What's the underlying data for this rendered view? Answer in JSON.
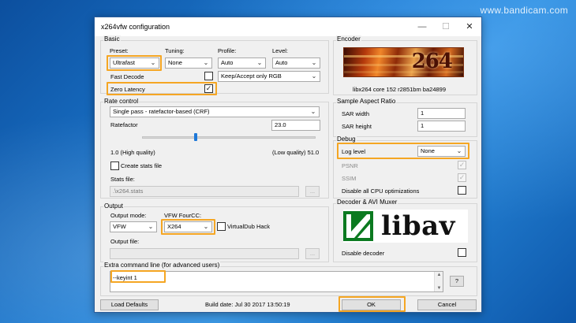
{
  "watermark": "www.bandicam.com",
  "window": {
    "title": "x264vfw configuration",
    "min": "—",
    "max": "☐",
    "close": "✕"
  },
  "basic": {
    "label": "Basic",
    "preset_label": "Preset:",
    "preset_value": "Ultrafast",
    "tuning_label": "Tuning:",
    "tuning_value": "None",
    "profile_label": "Profile:",
    "profile_value": "Auto",
    "level_label": "Level:",
    "level_value": "Auto",
    "fast_decode_label": "Fast Decode",
    "fast_decode_checked": false,
    "keep_value": "Keep/Accept only RGB",
    "zero_latency_label": "Zero Latency",
    "zero_latency_checked": true
  },
  "rate_control": {
    "label": "Rate control",
    "mode_value": "Single pass - ratefactor-based (CRF)",
    "ratefactor_label": "Ratefactor",
    "ratefactor_value": "23.0",
    "ratefactor_level": 0.31,
    "low_label": "1.0 (High quality)",
    "high_label": "(Low quality) 51.0",
    "create_stats_label": "Create stats file",
    "stats_file_label": "Stats file:",
    "stats_file_value": ".\\x264.stats",
    "browse_label": "..."
  },
  "output": {
    "label": "Output",
    "mode_label": "Output mode:",
    "mode_value": "VFW",
    "fourcc_label": "VFW FourCC:",
    "fourcc_value": "X264",
    "vdub_label": "VirtualDub Hack",
    "file_label": "Output file:",
    "browse_label": "..."
  },
  "encoder": {
    "label": "Encoder",
    "logo_text": "264",
    "version": "libx264 core 152 r2851bm ba24899"
  },
  "sar": {
    "label": "Sample Aspect Ratio",
    "width_label": "SAR width",
    "width_value": "1",
    "height_label": "SAR height",
    "height_value": "1"
  },
  "debug": {
    "label": "Debug",
    "log_level_label": "Log level",
    "log_level_value": "None",
    "psnr_label": "PSNR",
    "ssim_label": "SSIM",
    "disable_cpu_label": "Disable all CPU optimizations"
  },
  "decoder": {
    "label": "Decoder & AVI Muxer",
    "logo_text": "libav",
    "disable_label": "Disable decoder"
  },
  "extra": {
    "label": "Extra command line (for advanced users)",
    "value": "--keyint 1",
    "help_label": "?"
  },
  "footer": {
    "load_defaults": "Load Defaults",
    "build_date": "Build date: Jul 30 2017 13:50:19",
    "ok": "OK",
    "cancel": "Cancel"
  },
  "colors": {
    "highlight": "#f5a623",
    "titlebar": "#ffffff",
    "dialog": "#f0f0f0",
    "slider_thumb": "#1e78d8"
  }
}
